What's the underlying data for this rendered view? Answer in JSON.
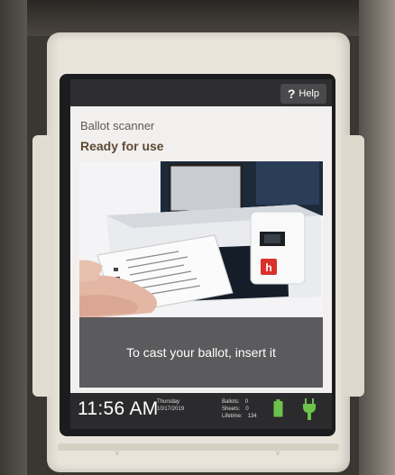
{
  "header": {
    "help_label": "Help"
  },
  "screen": {
    "title": "Ballot scanner",
    "status": "Ready for use",
    "instruction": "To cast your ballot, insert it"
  },
  "status_bar": {
    "time": "11:56 AM",
    "day": "Thursday",
    "date": "10/17/2019",
    "ballots_label": "Ballots:",
    "ballots_value": "0",
    "sheets_label": "Sheets:",
    "sheets_value": "0",
    "lifetime_label": "Lifetime:",
    "lifetime_value": "134",
    "battery_icon": "battery-full-icon",
    "power_icon": "power-plug-icon"
  },
  "colors": {
    "accent_green": "#6cc24a",
    "brand_red": "#d9312b",
    "banner": "#5b5a5c",
    "title_brown": "#5e4a36"
  }
}
